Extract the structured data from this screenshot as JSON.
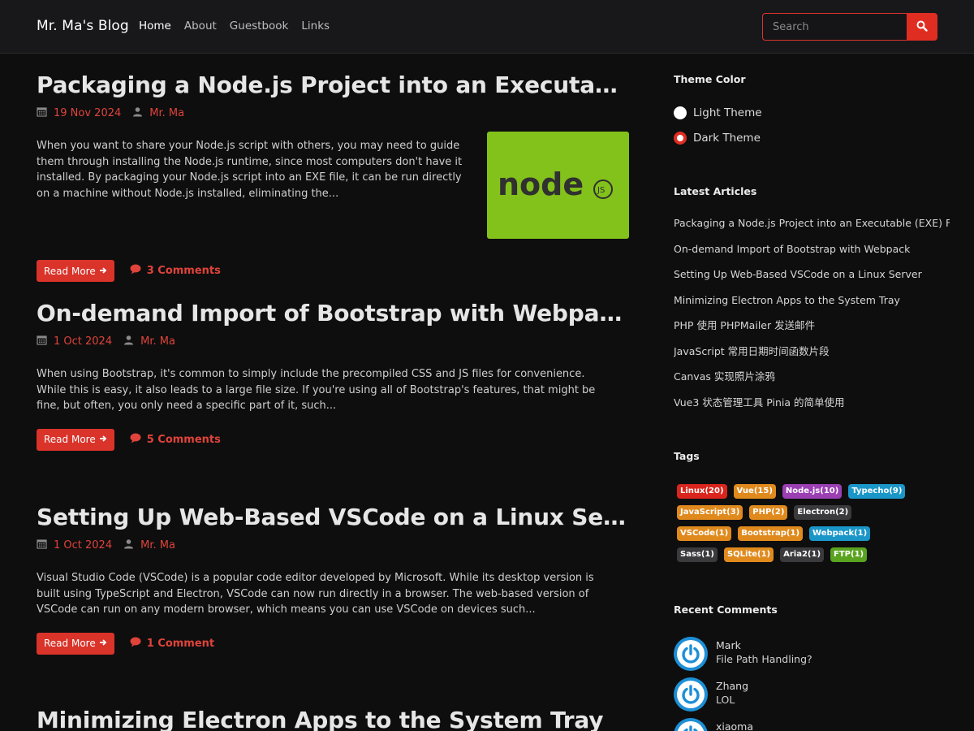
{
  "navbar": {
    "brand": "Mr. Ma's Blog",
    "links": [
      "Home",
      "About",
      "Guestbook",
      "Links"
    ],
    "search_placeholder": "Search"
  },
  "posts": [
    {
      "title": "Packaging a Node.js Project into an Executable (EXE) File",
      "date": "19 Nov 2024",
      "author": "Mr. Ma",
      "excerpt": "When you want to share your Node.js script with others, you may need to guide them through installing the Node.js runtime, since most computers don't have it installed. By packaging your Node.js script into an EXE file, it can be run directly on a machine without Node.js installed, eliminating the...",
      "thumbnail_text": "node",
      "thumbnail_badge": "JS",
      "read_more": "Read More",
      "comments": "3 Comments"
    },
    {
      "title": "On-demand Import of Bootstrap with Webpack",
      "date": "1 Oct 2024",
      "author": "Mr. Ma",
      "excerpt": "When using Bootstrap, it's common to simply include the precompiled CSS and JS files for convenience. While this is easy, it also leads to a large file size. If you're using all of Bootstrap's features, that might be fine, but often, you only need a specific part of it, such...",
      "read_more": "Read More",
      "comments": "5 Comments"
    },
    {
      "title": "Setting Up Web-Based VSCode on a Linux Server",
      "date": "1 Oct 2024",
      "author": "Mr. Ma",
      "excerpt": "Visual Studio Code (VSCode) is a popular code editor developed by Microsoft. While its desktop version is built using TypeScript and Electron, VSCode can now run directly in a browser. The web-based version of VSCode can run on any modern browser, which means you can use VSCode on devices such...",
      "read_more": "Read More",
      "comments": "1 Comment"
    },
    {
      "title": "Minimizing Electron Apps to the System Tray"
    }
  ],
  "sidebar": {
    "theme": {
      "title": "Theme Color",
      "options": [
        "Light Theme",
        "Dark Theme"
      ],
      "selected": "Dark Theme"
    },
    "latest": {
      "title": "Latest Articles",
      "items": [
        "Packaging a Node.js Project into an Executable (EXE) File",
        "On-demand Import of Bootstrap with Webpack",
        "Setting Up Web-Based VSCode on a Linux Server",
        "Minimizing Electron Apps to the System Tray",
        "PHP 使用 PHPMailer 发送邮件",
        "JavaScript 常用日期时间函数片段",
        "Canvas 实现照片涂鸦",
        "Vue3 状态管理工具 Pinia 的简单使用"
      ]
    },
    "tags": {
      "title": "Tags",
      "items": [
        {
          "label": "Linux(20)",
          "color": "#d9251d"
        },
        {
          "label": "Vue(15)",
          "color": "#e08a1e"
        },
        {
          "label": "Node.js(10)",
          "color": "#9b3fb3"
        },
        {
          "label": "Typecho(9)",
          "color": "#1a96c8"
        },
        {
          "label": "JavaScript(3)",
          "color": "#e08a1e"
        },
        {
          "label": "PHP(2)",
          "color": "#e08a1e"
        },
        {
          "label": "Electron(2)",
          "color": "#3a3a3d"
        },
        {
          "label": "VSCode(1)",
          "color": "#e08a1e"
        },
        {
          "label": "Bootstrap(1)",
          "color": "#e08a1e"
        },
        {
          "label": "Webpack(1)",
          "color": "#1a96c8"
        },
        {
          "label": "Sass(1)",
          "color": "#3a3a3d"
        },
        {
          "label": "SQLite(1)",
          "color": "#e08a1e"
        },
        {
          "label": "Aria2(1)",
          "color": "#3a3a3d"
        },
        {
          "label": "FTP(1)",
          "color": "#5aa320"
        }
      ]
    },
    "recent_comments": {
      "title": "Recent Comments",
      "items": [
        {
          "name": "Mark",
          "text": "File Path Handling?"
        },
        {
          "name": "Zhang",
          "text": "LOL"
        },
        {
          "name": "xiaoma",
          "text": ""
        }
      ]
    }
  },
  "colors": {
    "accent": "#e02d22",
    "background": "#0e0e0f",
    "navbar": "#18181b",
    "node_green": "#83c11b"
  }
}
